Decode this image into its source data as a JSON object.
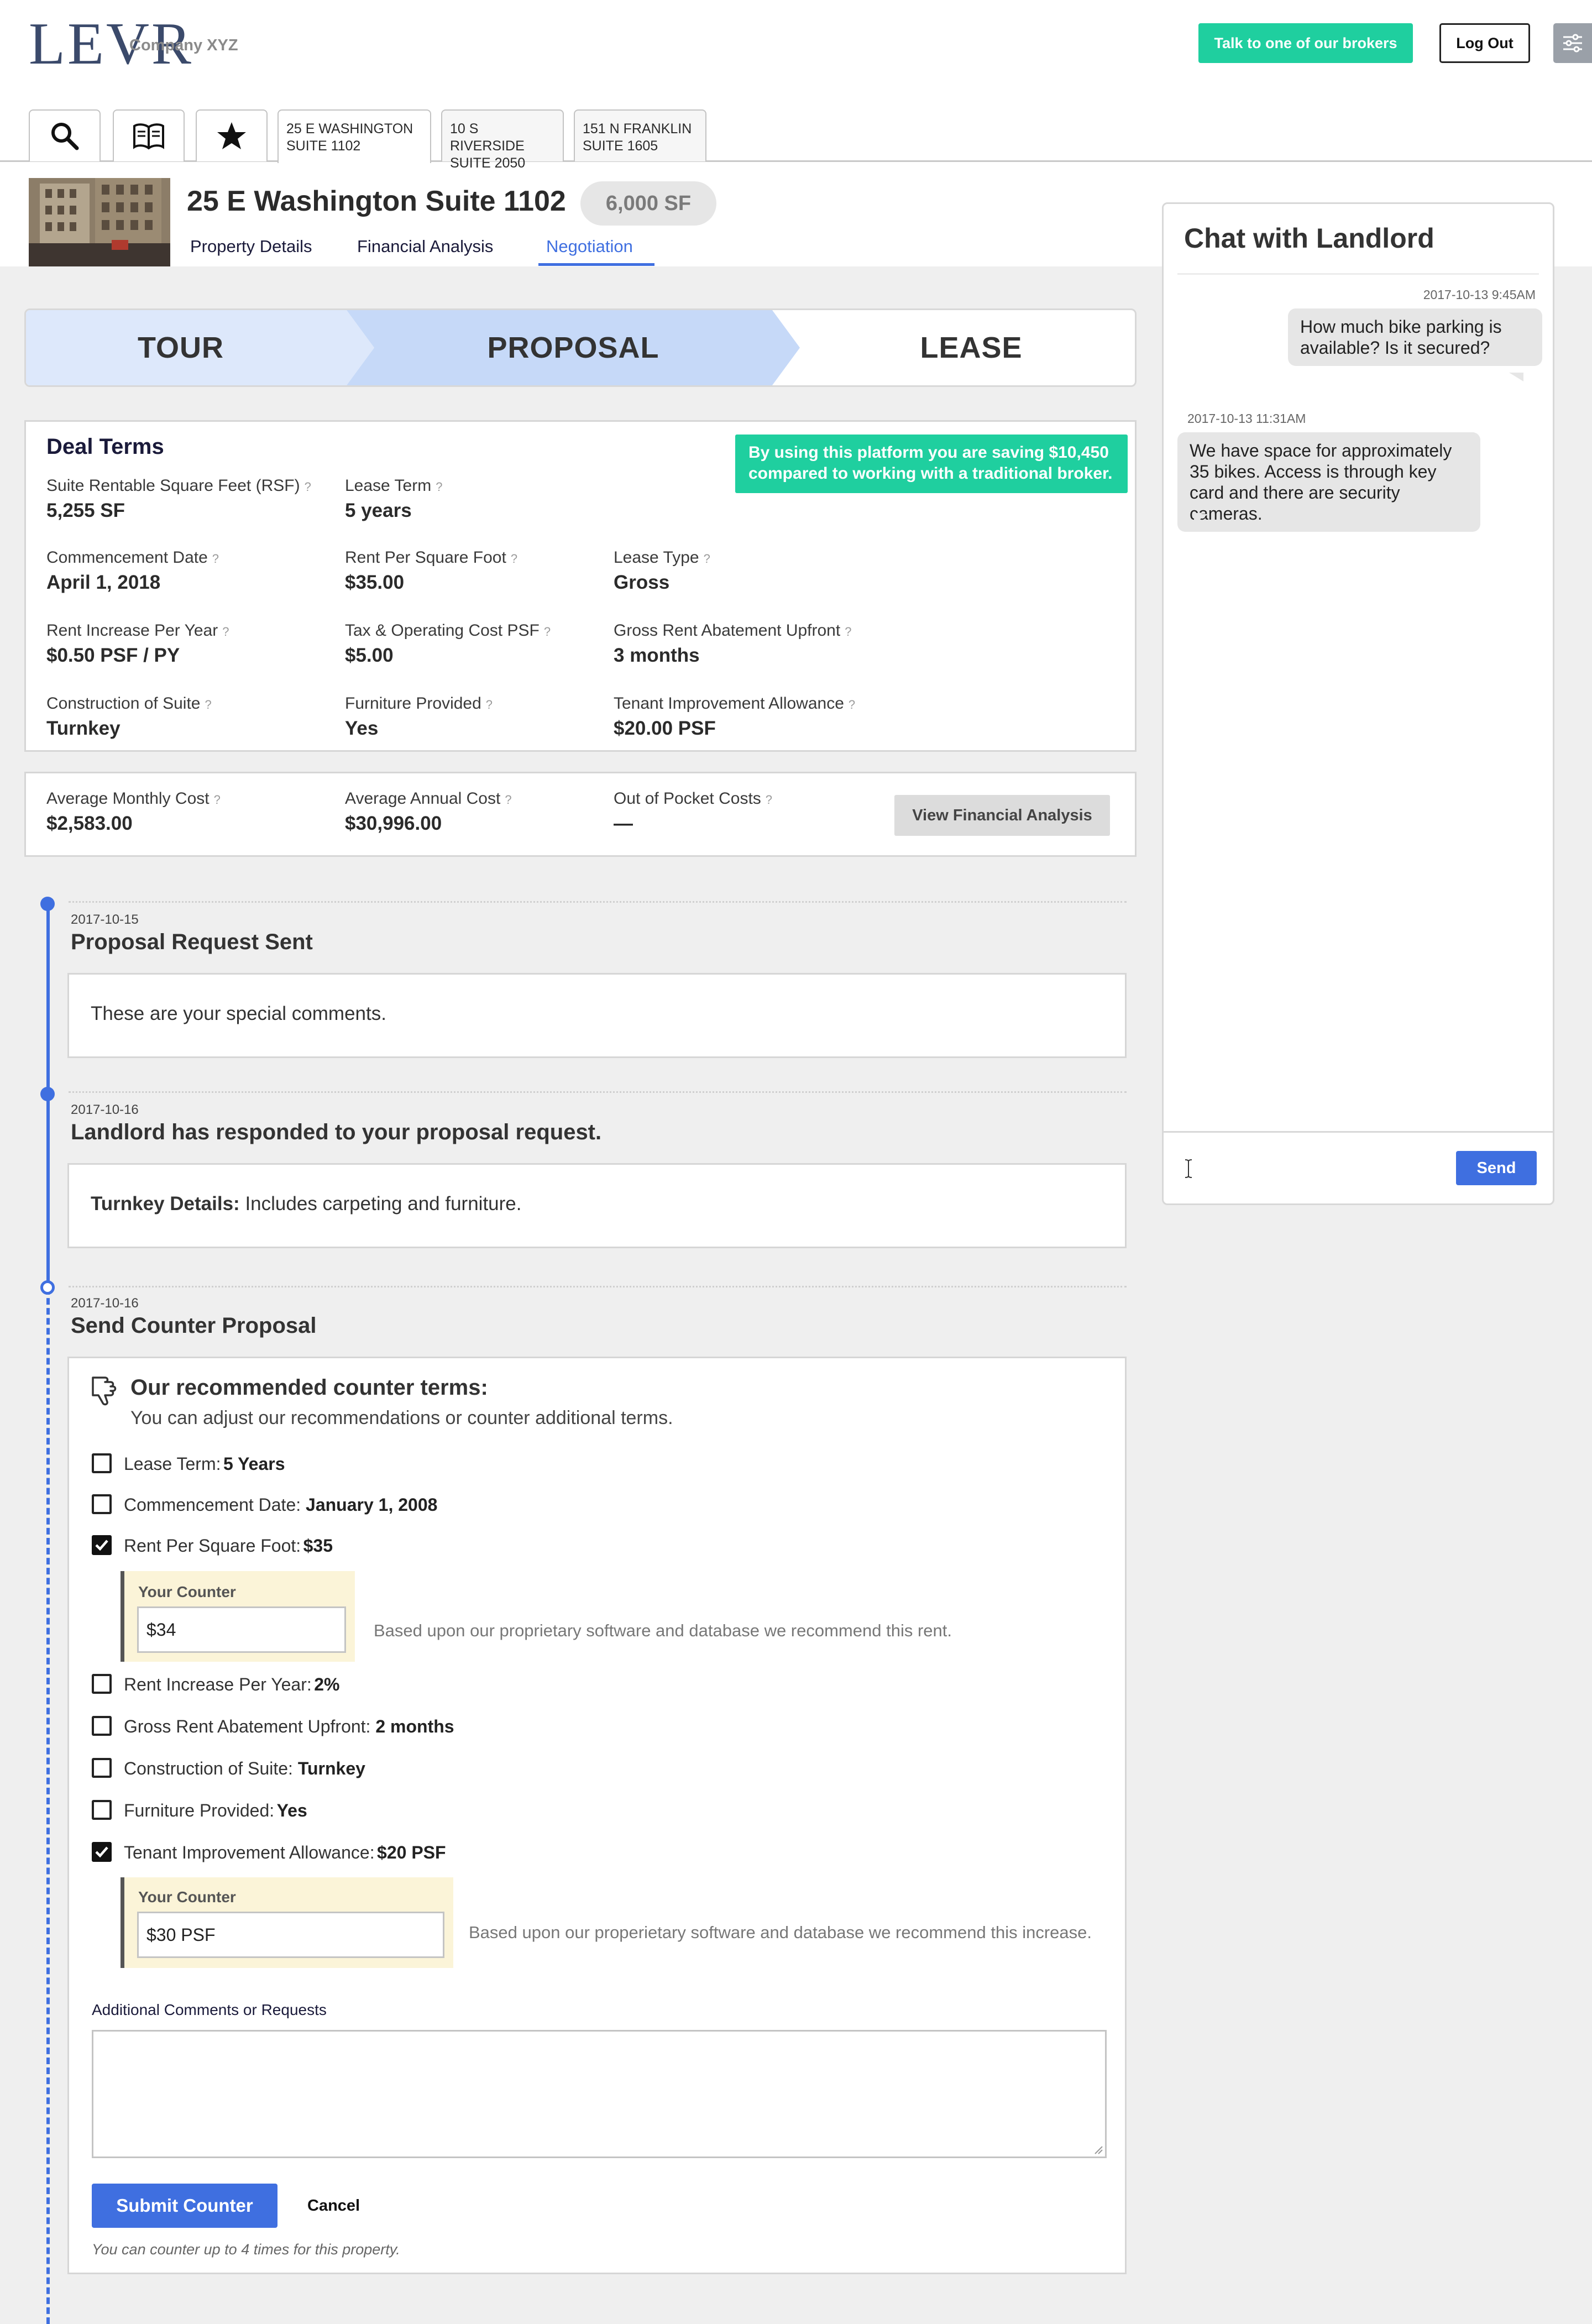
{
  "header": {
    "logo": "LEVR",
    "company": "Company XYZ",
    "broker_button": "Talk to one of our brokers",
    "logout_button": "Log Out"
  },
  "tabs": [
    {
      "line1": "25 E Washington",
      "line2": "Suite 1102"
    },
    {
      "line1": "10 S Riverside",
      "line2": "Suite 2050"
    },
    {
      "line1": "151 N Franklin",
      "line2": "Suite 1605"
    }
  ],
  "property": {
    "title": "25 E Washington Suite 1102",
    "size": "6,000 SF",
    "subnav": [
      "Property Details",
      "Financial Analysis",
      "Negotiation"
    ]
  },
  "steps": [
    "TOUR",
    "PROPOSAL",
    "LEASE"
  ],
  "deal_terms": {
    "heading": "Deal Terms",
    "savings": "By using this platform you are saving $10,450 compared to working with a traditional broker.",
    "fields": [
      {
        "label": "Suite Rentable Square Feet (RSF)",
        "value": "5,255 SF"
      },
      {
        "label": "Lease Term",
        "value": "5 years"
      },
      {
        "label": "Commencement Date",
        "value": "April 1, 2018"
      },
      {
        "label": "Rent Per Square Foot",
        "value": "$35.00"
      },
      {
        "label": "Lease Type",
        "value": "Gross"
      },
      {
        "label": "Rent Increase Per Year",
        "value": "$0.50 PSF / PY"
      },
      {
        "label": "Tax & Operating Cost PSF",
        "value": "$5.00"
      },
      {
        "label": "Gross Rent Abatement Upfront",
        "value": "3 months"
      },
      {
        "label": "Construction of Suite",
        "value": "Turnkey"
      },
      {
        "label": "Furniture Provided",
        "value": "Yes"
      },
      {
        "label": "Tenant Improvement Allowance",
        "value": "$20.00 PSF"
      }
    ]
  },
  "costs": {
    "fields": [
      {
        "label": "Average Monthly Cost",
        "value": "$2,583.00"
      },
      {
        "label": "Average Annual Cost",
        "value": "$30,996.00"
      },
      {
        "label": "Out of Pocket Costs",
        "value": "—"
      }
    ],
    "button": "View Financial Analysis"
  },
  "timeline": [
    {
      "date": "2017-10-15",
      "title": "Proposal Request Sent",
      "body": "These are your special comments."
    },
    {
      "date": "2017-10-16",
      "title": "Landlord has responded to your proposal request.",
      "body_label": "Turnkey Details:",
      "body": "Includes carpeting and furniture."
    },
    {
      "date": "2017-10-16",
      "title": "Send Counter Proposal"
    }
  ],
  "counter": {
    "heading": "Our recommended counter terms:",
    "subheading": "You can adjust our recommendations or counter additional terms.",
    "items": [
      {
        "label": "Lease Term:",
        "value": "5 Years",
        "checked": false
      },
      {
        "label": "Commencement Date:",
        "value": "January 1, 2008",
        "checked": false
      },
      {
        "label": "Rent Per Square Foot:",
        "value": "$35",
        "checked": true
      },
      {
        "label": "Rent Increase Per Year:",
        "value": "2%",
        "checked": false
      },
      {
        "label": "Gross Rent Abatement Upfront:",
        "value": "2 months",
        "checked": false
      },
      {
        "label": "Construction of Suite:",
        "value": "Turnkey",
        "checked": false
      },
      {
        "label": "Furniture Provided:",
        "value": "Yes",
        "checked": false
      },
      {
        "label": "Tenant Improvement Allowance:",
        "value": "$20 PSF",
        "checked": true
      }
    ],
    "your_counter_label": "Your Counter",
    "rent_counter_value": "$34",
    "rent_hint": "Based upon our proprietary software and database we recommend this rent.",
    "ti_counter_value": "$30 PSF",
    "ti_hint": "Based upon our properietary software and database we recommend this increase.",
    "comments_label": "Additional Comments or Requests",
    "submit": "Submit Counter",
    "cancel": "Cancel",
    "note": "You can counter up to 4 times for this property."
  },
  "chat": {
    "title": "Chat with Landlord",
    "messages": [
      {
        "time": "2017-10-13 9:45AM",
        "text": "How much bike parking is available? Is it secured?",
        "from": "me"
      },
      {
        "time": "2017-10-13 11:31AM",
        "text": "We have space for approximately 35 bikes. Access is through key card and there are security cameras.",
        "from": "landlord"
      }
    ],
    "send": "Send"
  },
  "colors": {
    "accent": "#3f6fe0",
    "green": "#1fcf9f",
    "highlight": "#fbf4d8"
  }
}
